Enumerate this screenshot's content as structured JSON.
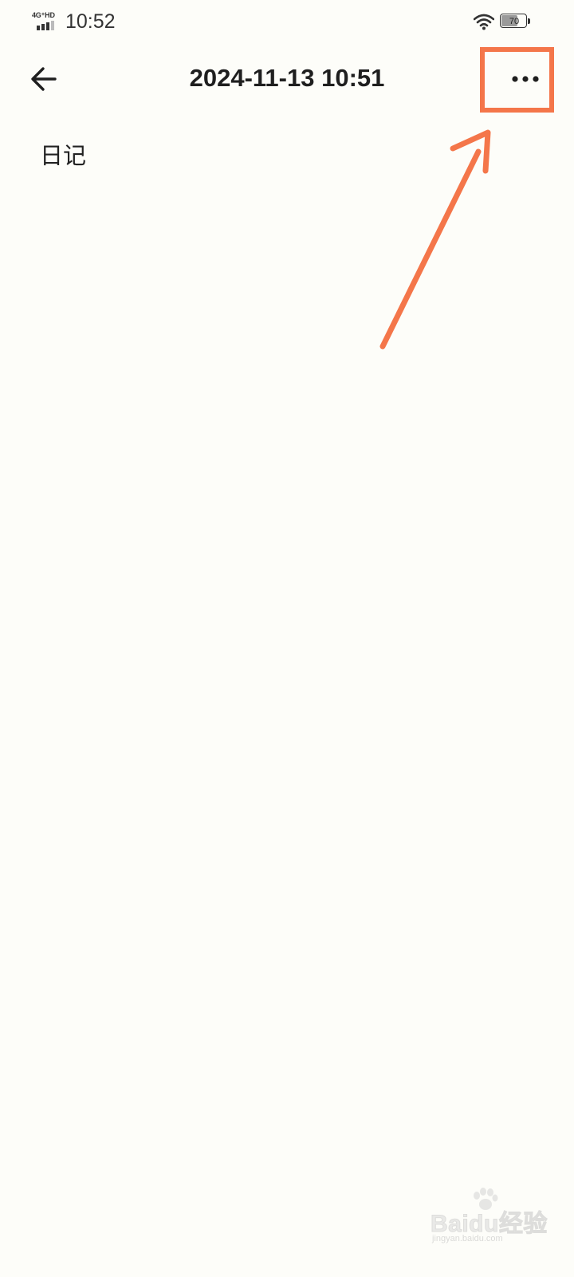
{
  "status_bar": {
    "network": "4G⁺HD",
    "time": "10:52",
    "battery_level": "70",
    "battery_fraction": 0.7
  },
  "header": {
    "title": "2024-11-13 10:51"
  },
  "note": {
    "body": "日记"
  },
  "watermark": {
    "brand": "Baidu经验",
    "url": "jingyan.baidu.com"
  },
  "colors": {
    "background": "#fdfdf9",
    "annotation": "#f4764a",
    "text": "#1f1f1f"
  },
  "icons": [
    "arrow-left-icon",
    "more-horizontal-icon",
    "wifi-icon",
    "battery-icon",
    "signal-icon"
  ]
}
